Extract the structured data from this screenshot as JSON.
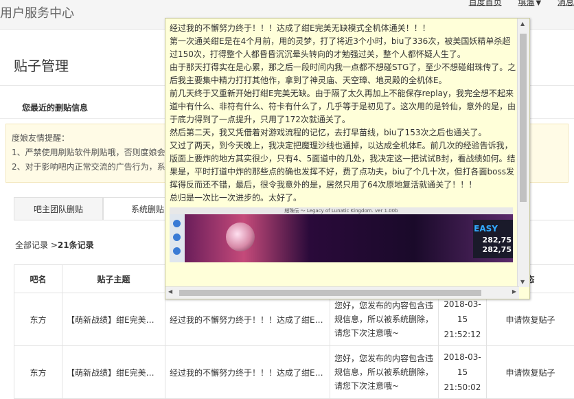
{
  "header": {
    "site_title": "用户服务中心",
    "links": [
      "百度首页",
      "填藩",
      "消息"
    ]
  },
  "page": {
    "title": "贴子管理"
  },
  "recent": {
    "label": "您最近的删贴信息"
  },
  "notice": {
    "title": "度娘友情提醒：",
    "line1": "1、严禁使用刷贴软件刷贴哦，否则度娘会",
    "line2": "2、对于影响吧内正常交流的广告行为，系"
  },
  "tabs": [
    "吧主团队删贴",
    "系统删贴"
  ],
  "records": {
    "prefix": "全部记录 >",
    "count": "21条记录"
  },
  "table": {
    "headers": [
      "吧名",
      "贴子主题",
      "",
      "",
      "",
      "态"
    ],
    "rows": [
      {
        "bar": "东方",
        "topic": "【萌新战绩】绀E完美无…",
        "content": "经过我的不懈努力终于！！！达成了绀E完…",
        "reason": "您好，您发布的内容包含违规信息，所以被系统删除，请您下次注意哦~",
        "date": "2018-03-15",
        "time": "21:52:12",
        "action": "申请恢复贴子"
      },
      {
        "bar": "东方",
        "topic": "【萌新战绩】绀E完美无…",
        "content": "经过我的不懈努力终于！！！达成了绀E完…",
        "reason": "您好，您发布的内容包含违规信息，所以被系统删除，请您下次注意哦~",
        "date": "2018-03-15",
        "time": "21:50:02",
        "action": "申请恢复贴子"
      }
    ]
  },
  "popup": {
    "p1": "经过我的不懈努力终于！！！达成了绀E完美无缺模式全机体通关！！！",
    "p2": "第一次通关绀E是在4个月前，用的灵梦，打了将近3个小时，biu了336次，被美国妖精单杀超过150次，打得整个人都昏昏沉沉晕头转向的才勉强过关，整个人都怀疑人生了。",
    "p3": "由于那天打得实在是心累，那之后一段时间内我一点都不想碰STG了，至少不想碰绀珠传了。之后我主要集中精力打打其他作，拿到了神灵庙、天空璋、地灵殿的全机体E。",
    "p4": "前几天终于又重新开始打绀E完美无缺。由于隔了太久再加上不能保存replay，我完全想不起来道中有什么、非符有什么、符卡有什么了，几乎等于是初见了。这次用的是铃仙，意外的是，由于底力得到了一点提升，只用了172次就通关了。",
    "p5": "然后第二天，我又凭借着对游戏流程的记忆，去打早苗线，biu了153次之后也通关了。",
    "p6": "又过了两天，到今天晚上，我决定把魔理沙线也通掉，以达成全机体E。前几次的经验告诉我，版面上要炸的地方其实很少，只有4、5面道中的几处，我决定这一把试试B封，看战绩如何。结果是，平时打道中炸的那些点的确也发挥不好，费了点功夫，biu了个几十次，但打各面boss发挥得反而还不错，最后，很令我意外的是，居然只用了64次原地复活就通关了！！！",
    "p7": "总归是一次比一次进步的。太好了。",
    "shot_title": "紺珠伝 ～ Legacy of Lunatic Kingdom. ver 1.00b",
    "shot_mode": "EASY",
    "shot_score1": "282,75",
    "shot_score2": "282,75"
  }
}
